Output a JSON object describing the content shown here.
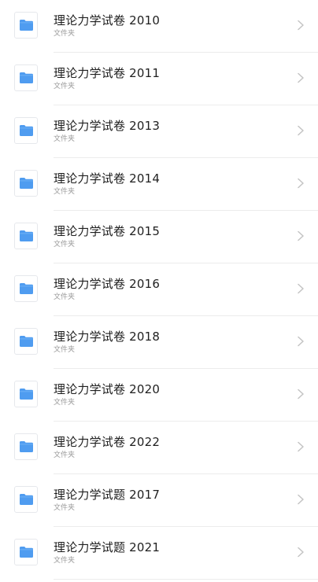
{
  "folders": [
    {
      "title": "理论力学试卷 2010",
      "subtitle": "文件夹"
    },
    {
      "title": "理论力学试卷 2011",
      "subtitle": "文件夹"
    },
    {
      "title": "理论力学试卷 2013",
      "subtitle": "文件夹"
    },
    {
      "title": "理论力学试卷 2014",
      "subtitle": "文件夹"
    },
    {
      "title": "理论力学试卷 2015",
      "subtitle": "文件夹"
    },
    {
      "title": "理论力学试卷 2016",
      "subtitle": "文件夹"
    },
    {
      "title": "理论力学试卷 2018",
      "subtitle": "文件夹"
    },
    {
      "title": "理论力学试卷 2020",
      "subtitle": "文件夹"
    },
    {
      "title": "理论力学试卷 2022",
      "subtitle": "文件夹"
    },
    {
      "title": "理论力学试题 2017",
      "subtitle": "文件夹"
    },
    {
      "title": "理论力学试题 2021",
      "subtitle": "文件夹"
    }
  ],
  "icons": {
    "item": "folder-icon",
    "trailing": "chevron-right-icon"
  },
  "colors": {
    "folder": "#4f9cf0",
    "folder_tab": "#6aaef5",
    "chevron": "#c4c4c4",
    "divider": "#ececec"
  }
}
